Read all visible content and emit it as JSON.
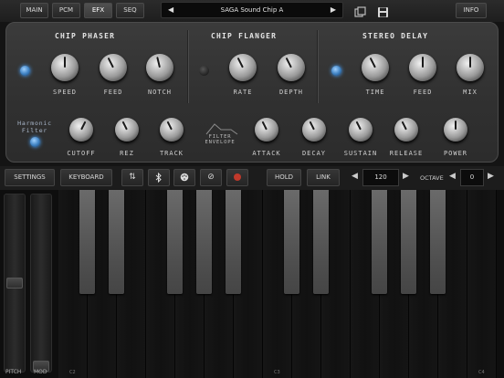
{
  "topbar": {
    "tabs": [
      {
        "label": "MAIN",
        "active": false
      },
      {
        "label": "PCM",
        "active": false
      },
      {
        "label": "EFX",
        "active": true
      },
      {
        "label": "SEQ",
        "active": false
      }
    ],
    "preset_name": "SAGA Sound Chip A",
    "prev_icon": "triangle-left-icon",
    "next_icon": "triangle-right-icon",
    "copy_icon": "copy-icon",
    "save_icon": "save-icon",
    "info_label": "INFO"
  },
  "effects": {
    "chip_phaser": {
      "title": "CHIP PHASER",
      "enabled": true,
      "knobs": [
        {
          "label": "SPEED",
          "value": 0.5
        },
        {
          "label": "FEED",
          "value": 0.4
        },
        {
          "label": "NOTCH",
          "value": 0.45
        }
      ]
    },
    "chip_flanger": {
      "title": "CHIP FLANGER",
      "enabled": false,
      "knobs": [
        {
          "label": "RATE",
          "value": 0.4
        },
        {
          "label": "DEPTH",
          "value": 0.4
        }
      ]
    },
    "stereo_delay": {
      "title": "STEREO DELAY",
      "enabled": true,
      "knobs": [
        {
          "label": "TIME",
          "value": 0.4
        },
        {
          "label": "FEED",
          "value": 0.5
        },
        {
          "label": "MIX",
          "value": 0.5
        }
      ]
    },
    "harmonic_filter": {
      "label_line1": "Harmonic",
      "label_line2": "Filter",
      "enabled": true,
      "knobs": [
        {
          "label": "CUTOFF",
          "value": 0.6
        },
        {
          "label": "REZ",
          "value": 0.4
        },
        {
          "label": "TRACK",
          "value": 0.4
        }
      ]
    },
    "filter_envelope": {
      "label_line1": "FILTER",
      "label_line2": "ENVELOPE",
      "knobs": [
        {
          "label": "ATTACK",
          "value": 0.4
        },
        {
          "label": "DECAY",
          "value": 0.4
        },
        {
          "label": "SUSTAIN",
          "value": 0.4
        },
        {
          "label": "RELEASE",
          "value": 0.4
        },
        {
          "label": "POWER",
          "value": 0.5
        }
      ]
    }
  },
  "controls": {
    "settings_label": "SETTINGS",
    "keyboard_label": "KEYBOARD",
    "icons": [
      "sort-icon",
      "bluetooth-icon",
      "midi-icon",
      "block-icon",
      "record-icon"
    ],
    "hold_label": "HOLD",
    "link_label": "LINK",
    "tempo_value": "120",
    "octave_label": "OCTAVE",
    "octave_value": "0",
    "accent_record": "#c0392b"
  },
  "keyboard": {
    "pitch_label": "PITCH",
    "mod_label": "MOD",
    "pitch_level": 0.5,
    "mod_level": 0.0,
    "octave_labels": [
      "C2",
      "C3",
      "C4"
    ]
  }
}
